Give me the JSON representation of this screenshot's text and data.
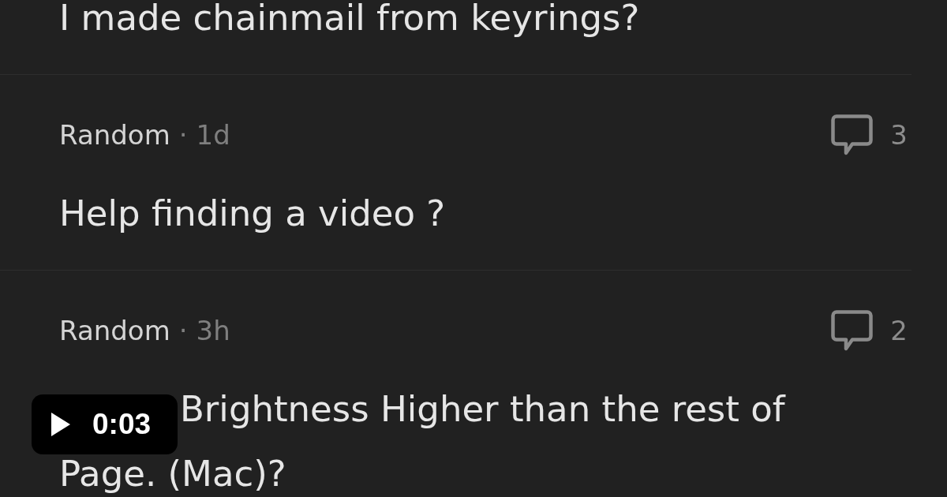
{
  "posts": [
    {
      "title_lines": [
        "I made chainmail from keyrings?"
      ]
    },
    {
      "category": "Random",
      "separator": "·",
      "age": "1d",
      "comments": "3",
      "title_lines": [
        "Help finding a video ?"
      ]
    },
    {
      "category": "Random",
      "separator": "·",
      "age": "3h",
      "comments": "2",
      "title_lines": [
        "Brightness Higher than the rest of",
        "Page. (Mac)?"
      ]
    }
  ],
  "video_overlay": {
    "duration": "0:03"
  }
}
